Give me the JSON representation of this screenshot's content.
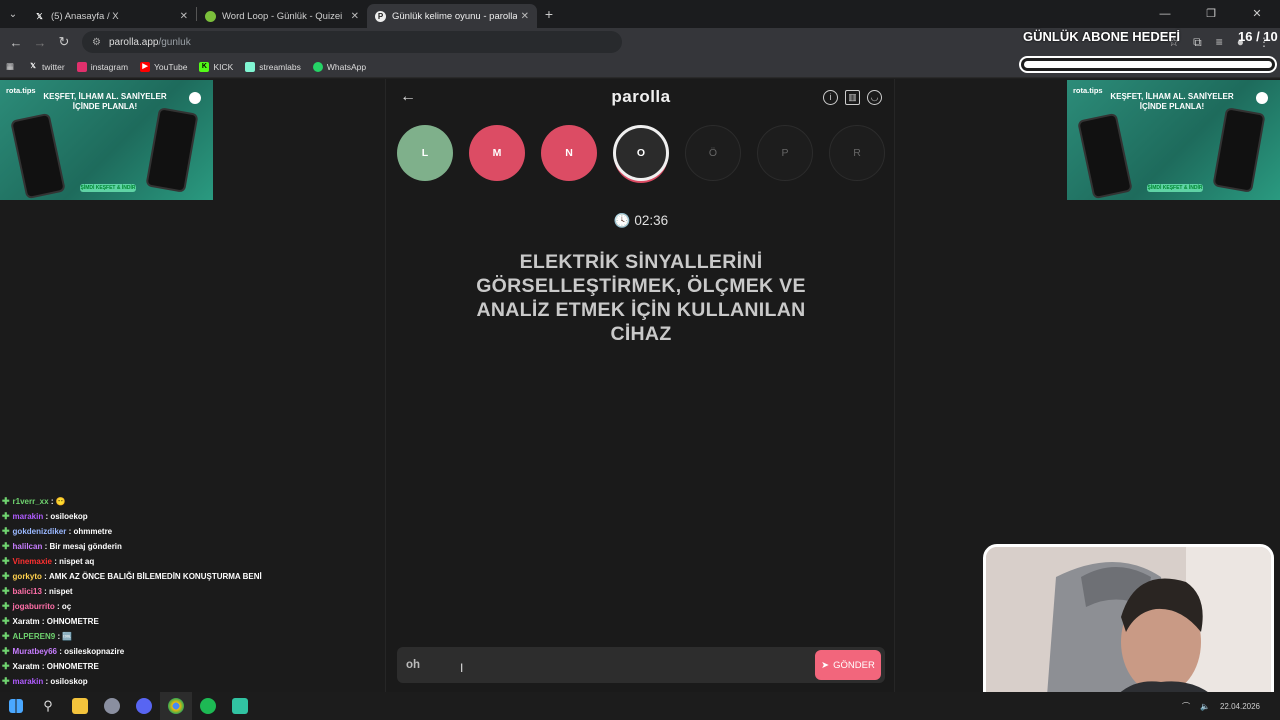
{
  "browser": {
    "tabs": [
      {
        "title": "(5) Anasayfa / X",
        "favicon": "x-logo-icon",
        "active": false
      },
      {
        "title": "Word Loop - Günlük - Quizei",
        "favicon": "quizei-icon",
        "active": false
      },
      {
        "title": "Günlük kelime oyunu - parolla",
        "favicon": "parolla-icon",
        "active": true
      }
    ],
    "url": {
      "host": "parolla.app",
      "path": "/gunluk"
    },
    "bookmarks": [
      "twitter",
      "instagram",
      "YouTube",
      "KICK",
      "streamlabs",
      "WhatsApp"
    ]
  },
  "ads": {
    "brand": "rota.tips",
    "tagline": "KEŞFET, İLHAM AL. SANİYELER İÇİNDE PLANLA!",
    "cta": "ŞİMDİ KEŞFET & İNDİR"
  },
  "game": {
    "logo": "parolla",
    "letters": [
      {
        "letter": "L",
        "state": "correct"
      },
      {
        "letter": "M",
        "state": "wrong"
      },
      {
        "letter": "N",
        "state": "wrong"
      },
      {
        "letter": "O",
        "state": "current"
      },
      {
        "letter": "Ö",
        "state": "pending"
      },
      {
        "letter": "P",
        "state": "pending"
      },
      {
        "letter": "R",
        "state": "pending"
      }
    ],
    "timer": "02:36",
    "clue": "ELEKTRİK SİNYALLERİNİ GÖRSELLEŞTİRMEK, ÖLÇMEK VE ANALİZ ETMEK İÇİN KULLANILAN CİHAZ",
    "input_value": "oh",
    "send_label": "GÖNDER"
  },
  "stream_overlay": {
    "goal_title": "GÜNLÜK ABONE HEDEFİ",
    "goal_count": "16 / 10",
    "goal_progress": 1.0
  },
  "chat": [
    {
      "user": "r1verr_xx",
      "msg": "😶",
      "color": "#6fd36f"
    },
    {
      "user": "marakin",
      "msg": "osiloekop",
      "color": "#b05cff"
    },
    {
      "user": "gokdenizdiker",
      "msg": "ohmmetre",
      "color": "#9ab8ff"
    },
    {
      "user": "halilcan",
      "msg": "Bir mesaj gönderin",
      "color": "#c77dff"
    },
    {
      "user": "Vinemaxie",
      "msg": "nispet aq",
      "color": "#ff3030"
    },
    {
      "user": "gorkyto",
      "msg": "AMK AZ ÖNCE BALIĞI BİLEMEDİN KONUŞTURMA BENİ",
      "color": "#ffd04d"
    },
    {
      "user": "balici13",
      "msg": "nispet",
      "color": "#ff6fa8"
    },
    {
      "user": "jogaburrito",
      "msg": "oç",
      "color": "#ff6fa8"
    },
    {
      "user": "Xaratm",
      "msg": "OHNOMETRE",
      "color": "#ffffff"
    },
    {
      "user": "ALPEREN9",
      "msg": "🆒",
      "color": "#6fd36f"
    },
    {
      "user": "Muratbey66",
      "msg": "osileskopnazire",
      "color": "#c77dff"
    },
    {
      "user": "Xaratm",
      "msg": "OHNOMETRE",
      "color": "#ffffff"
    },
    {
      "user": "marakin",
      "msg": "osiloskop",
      "color": "#b05cff"
    }
  ],
  "taskbar": {
    "date": "22.04.2026"
  }
}
